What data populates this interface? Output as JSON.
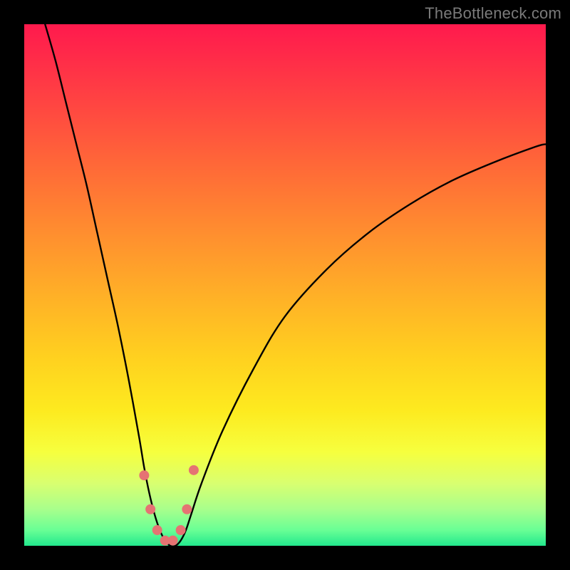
{
  "watermark": "TheBottleneck.com",
  "chart_data": {
    "type": "line",
    "title": "",
    "xlabel": "",
    "ylabel": "",
    "xlim": [
      0,
      100
    ],
    "ylim": [
      0,
      100
    ],
    "grid": false,
    "legend": false,
    "background_gradient": {
      "direction": "vertical",
      "stops": [
        {
          "pos": 0.0,
          "color": "#ff1a4d"
        },
        {
          "pos": 0.3,
          "color": "#ff6b37"
        },
        {
          "pos": 0.6,
          "color": "#ffc820"
        },
        {
          "pos": 0.82,
          "color": "#f6ff3e"
        },
        {
          "pos": 1.0,
          "color": "#22e98d"
        }
      ]
    },
    "series": [
      {
        "name": "bottleneck-curve",
        "color": "#000000",
        "x": [
          4,
          6,
          8,
          10,
          12,
          14,
          16,
          18,
          20,
          22,
          23,
          24,
          25,
          26,
          27,
          28,
          29,
          30,
          31,
          32,
          34,
          38,
          44,
          50,
          58,
          66,
          74,
          82,
          90,
          98,
          100
        ],
        "y": [
          100,
          93,
          85,
          77,
          69,
          60,
          51,
          42,
          32,
          21,
          15,
          10,
          6,
          3,
          1,
          0,
          0,
          1,
          3,
          6,
          12,
          22,
          34,
          44,
          53,
          60,
          65.5,
          70,
          73.5,
          76.5,
          77
        ]
      }
    ],
    "markers": [
      {
        "name": "marker",
        "color": "#e57373",
        "radius_px": 7,
        "x": 23.0,
        "y": 13.5
      },
      {
        "name": "marker",
        "color": "#e57373",
        "radius_px": 7,
        "x": 24.2,
        "y": 7.0
      },
      {
        "name": "marker",
        "color": "#e57373",
        "radius_px": 7,
        "x": 25.5,
        "y": 3.0
      },
      {
        "name": "marker",
        "color": "#e57373",
        "radius_px": 7,
        "x": 27.0,
        "y": 1.0
      },
      {
        "name": "marker",
        "color": "#e57373",
        "radius_px": 7,
        "x": 28.5,
        "y": 1.0
      },
      {
        "name": "marker",
        "color": "#e57373",
        "radius_px": 7,
        "x": 30.0,
        "y": 3.0
      },
      {
        "name": "marker",
        "color": "#e57373",
        "radius_px": 7,
        "x": 31.2,
        "y": 7.0
      },
      {
        "name": "marker",
        "color": "#e57373",
        "radius_px": 7,
        "x": 32.5,
        "y": 14.5
      }
    ]
  }
}
